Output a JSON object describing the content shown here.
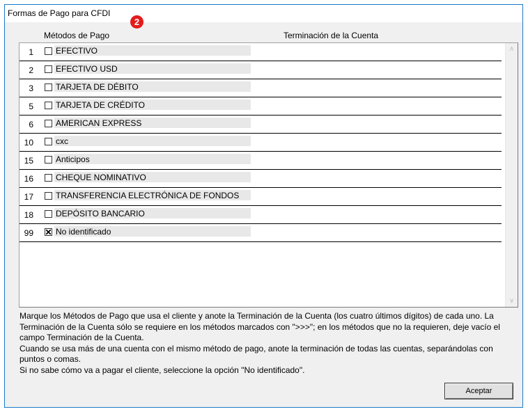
{
  "window": {
    "title": "Formas de Pago para CFDI",
    "badge": "2"
  },
  "columns": {
    "metodos": "Métodos de Pago",
    "terminacion": "Terminación de la Cuenta"
  },
  "methods": [
    {
      "code": "1",
      "label": "EFECTIVO",
      "checked": false
    },
    {
      "code": "2",
      "label": "EFECTIVO USD",
      "checked": false
    },
    {
      "code": "3",
      "label": "TARJETA DE DÉBITO",
      "checked": false
    },
    {
      "code": "5",
      "label": "TARJETA DE CRÉDITO",
      "checked": false
    },
    {
      "code": "6",
      "label": "AMERICAN EXPRESS",
      "checked": false
    },
    {
      "code": "10",
      "label": "cxc",
      "checked": false
    },
    {
      "code": "15",
      "label": "Anticipos",
      "checked": false
    },
    {
      "code": "16",
      "label": "CHEQUE NOMINATIVO",
      "checked": false
    },
    {
      "code": "17",
      "label": "TRANSFERENCIA ELECTRÓNICA DE FONDOS",
      "checked": false
    },
    {
      "code": "18",
      "label": "DEPÓSITO BANCARIO",
      "checked": false
    },
    {
      "code": "99",
      "label": "No identificado",
      "checked": true
    }
  ],
  "help": {
    "p1": "Marque los Métodos de Pago que usa el cliente y anote la Terminación de la Cuenta (los cuatro últimos dígitos) de cada uno. La Terminación de la Cuenta sólo se requiere en los métodos marcados con \">>>\"; en los métodos que no la requieren, deje vacío el campo Terminación de la Cuenta.",
    "p2": "Cuando se usa más de una cuenta con el mismo método de pago, anote la terminación de todas las cuentas, separándolas con puntos o comas.",
    "p3": "Si no sabe cómo va a pagar el cliente, seleccione la opción \"No identificado\"."
  },
  "buttons": {
    "accept": "Aceptar"
  },
  "colors": {
    "border_accent": "#1979ca",
    "badge": "#e31b1b"
  }
}
